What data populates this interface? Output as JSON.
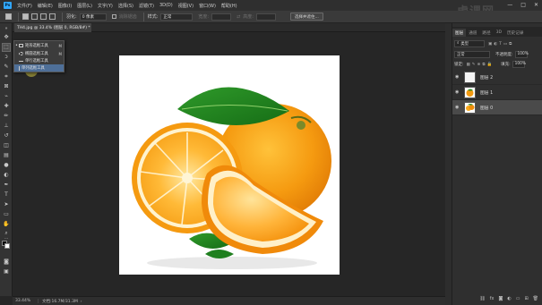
{
  "app": {
    "logo_text": "Ps",
    "menu": [
      "文件(F)",
      "编辑(E)",
      "图像(I)",
      "图层(L)",
      "文字(Y)",
      "选择(S)",
      "滤镜(T)",
      "3D(D)",
      "视图(V)",
      "窗口(W)",
      "帮助(H)"
    ],
    "window_controls": [
      "—",
      "□",
      "✕"
    ]
  },
  "options_bar": {
    "feather_label": "羽化:",
    "feather_value": "0 像素",
    "antialias_label": "消除锯齿",
    "style_label": "样式:",
    "style_value": "正常",
    "width_label": "宽度:",
    "height_label": "高度:",
    "select_and_mask": "选择并遮住..."
  },
  "document_tab": {
    "title": "TH4.jpg @ 33.4% (图层 0, RGB/8#) *",
    "close": "×"
  },
  "tool_flyout": {
    "items": [
      {
        "bullet": "•",
        "icon": "rect-marquee-icon",
        "label": "矩形选框工具",
        "shortcut": "M"
      },
      {
        "bullet": "",
        "icon": "elliptical-marquee-icon",
        "label": "椭圆选框工具",
        "shortcut": "M"
      },
      {
        "bullet": "",
        "icon": "single-row-marquee-icon",
        "label": "单行选框工具",
        "shortcut": ""
      },
      {
        "bullet": "",
        "icon": "single-column-marquee-icon",
        "label": "单列选框工具",
        "shortcut": ""
      }
    ]
  },
  "status_bar": {
    "zoom": "33.44%",
    "doc_info": "文档:16.7M/31.3M",
    "arrow": "›"
  },
  "layers_panel": {
    "tabs": [
      "图层",
      "通道",
      "路径",
      "3D",
      "历史记录"
    ],
    "filter_label": "类型",
    "blend_mode": "正常",
    "opacity_label": "不透明度:",
    "opacity_value": "100%",
    "lock_label": "锁定:",
    "fill_label": "填充:",
    "fill_value": "100%",
    "layers": [
      {
        "name": "图层 2",
        "thumb": "white-layer"
      },
      {
        "name": "图层 1",
        "thumb": "orange-cut-layer"
      },
      {
        "name": "图层 0",
        "thumb": "orange-photo-layer"
      }
    ],
    "footer_icons": [
      "link-icon",
      "fx-icon",
      "mask-icon",
      "adjustment-icon",
      "group-icon",
      "new-layer-icon",
      "trash-icon"
    ]
  },
  "watermark": "虎课网"
}
